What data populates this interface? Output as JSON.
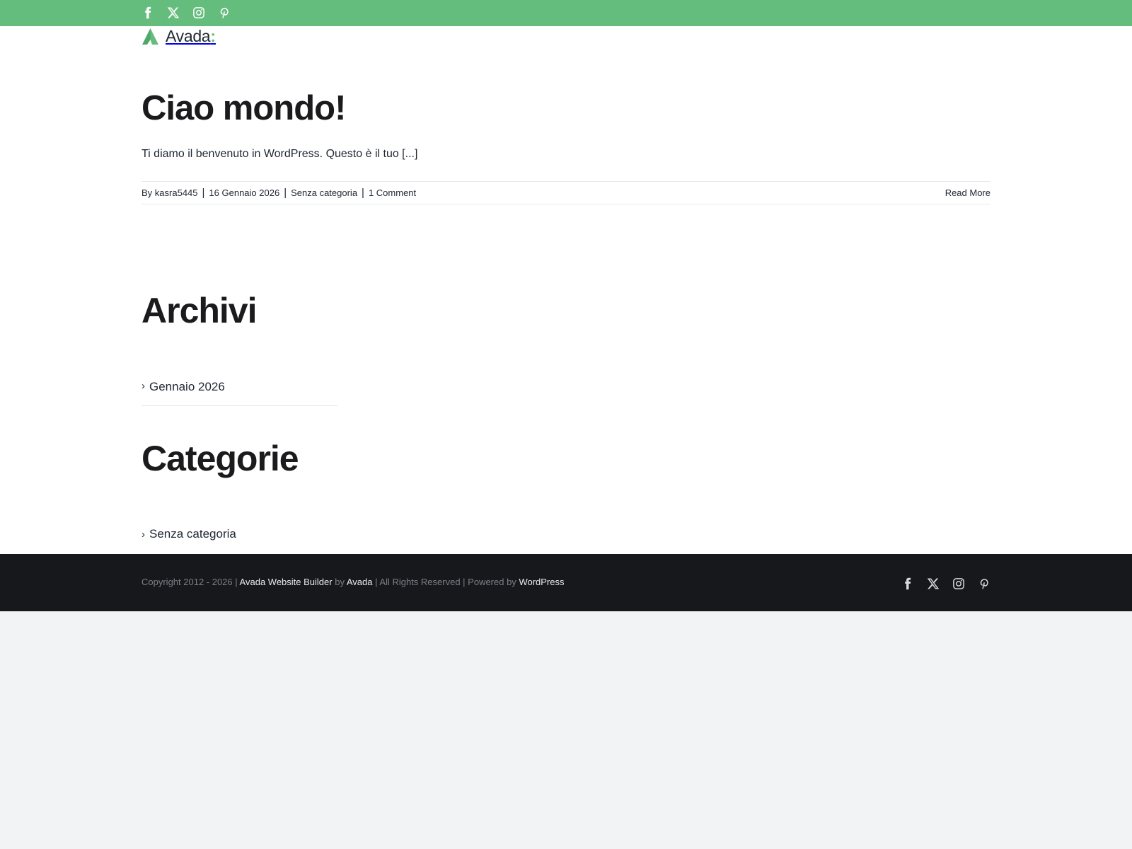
{
  "topbar": {
    "social": [
      {
        "icon": "facebook-icon",
        "label": "Facebook"
      },
      {
        "icon": "x-icon",
        "label": "X"
      },
      {
        "icon": "instagram-icon",
        "label": "Instagram"
      },
      {
        "icon": "pinterest-icon",
        "label": "Pinterest"
      }
    ]
  },
  "logo": {
    "text": "Avada",
    "colon": ":"
  },
  "post": {
    "title": "Ciao mondo!",
    "excerpt": "Ti diamo il benvenuto in WordPress. Questo è il tuo [...]",
    "meta": {
      "by": "By",
      "author": "kasra5445",
      "date": "16 Gennaio 2026",
      "category": "Senza categoria",
      "comments": "1 Comment",
      "separator": "|"
    },
    "read_more": "Read More"
  },
  "widgets": {
    "archivi": {
      "title": "Archivi",
      "items": [
        "Gennaio 2026"
      ]
    },
    "categorie": {
      "title": "Categorie",
      "items": [
        "Senza categoria"
      ]
    }
  },
  "footer": {
    "copyright_prefix": "Copyright 2012 - 2026 |",
    "builder_link": "Avada Website Builder",
    "by": "by",
    "avada_link": "Avada",
    "rights": "| All Rights Reserved | Powered by",
    "wordpress_link": "WordPress"
  },
  "colors": {
    "accent": "#65bd7d",
    "footer_bg": "#17181b",
    "page_bg": "#ffffff",
    "outer_bg": "#f2f3f5"
  }
}
